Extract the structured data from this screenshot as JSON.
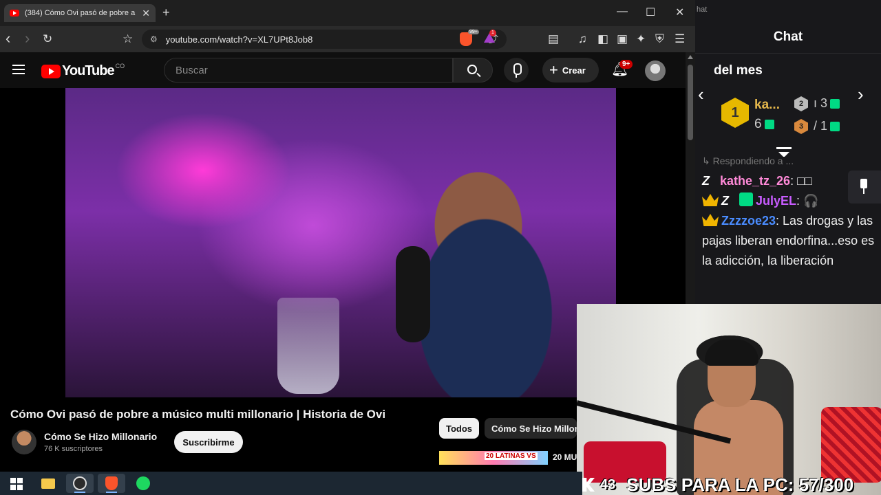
{
  "browser": {
    "tab": {
      "title": "(384) Cómo Ovi pasó de pobre a",
      "close": "✕"
    },
    "new_tab": "+",
    "window": {
      "minimize": "—",
      "maximize": "☐",
      "close": "✕"
    },
    "nav": {
      "back": "‹",
      "forward": "›",
      "reload": "↻",
      "bookmark": "☆"
    },
    "address": "youtube.com/watch?v=XL7UPt8Job8",
    "shields_count": "99+",
    "rewards_count": "1",
    "icons": [
      "reader-mode-icon",
      "music-icon",
      "sidebar-icon",
      "wallet-icon",
      "leo-icon",
      "vpn-icon",
      "menu-icon"
    ]
  },
  "youtube": {
    "logo_text": "YouTube",
    "country_code": "CO",
    "search_placeholder": "Buscar",
    "create_label": "Crear",
    "notification_badge": "9+",
    "video": {
      "title": "Cómo Ovi pasó de pobre a músico multi millonario | Historia de Ovi"
    },
    "channel": {
      "name": "Cómo Se Hizo Millonario",
      "subscribers": "76 K suscriptores",
      "subscribe_label": "Suscribirme"
    },
    "chips": [
      "Todos",
      "Cómo Se Hizo Millonario"
    ],
    "next_video": {
      "thumb_text": "20 LATINAS VS",
      "title": "20 MU"
    }
  },
  "chat": {
    "window_label": "hat",
    "title": "Chat",
    "leaderboard": {
      "heading": "del mes",
      "prev": "‹",
      "next": "›",
      "first": {
        "rank": "1",
        "name": "ka...",
        "count": "6"
      },
      "second": {
        "rank": "2",
        "value": "ı 3"
      },
      "third": {
        "rank": "3",
        "value": "/ 1"
      }
    },
    "messages": {
      "faded": "↳ Respondiendo a ...",
      "m1": {
        "user": "kathe_tz_26",
        "text": "□□"
      },
      "m2": {
        "user": "JulyEL",
        "text": ""
      },
      "m3": {
        "user": "Zzzzoe23",
        "text": "Las drogas y las pajas liberan endorfina...eso es la adicción, la liberación"
      }
    }
  },
  "overlay": {
    "kick_count": "43",
    "subs_text": "SUBS PARA LA PC: 57/300"
  },
  "taskbar": {
    "apps": [
      "windows-start",
      "file-explorer",
      "obs-studio",
      "brave-browser",
      "spotify"
    ]
  }
}
